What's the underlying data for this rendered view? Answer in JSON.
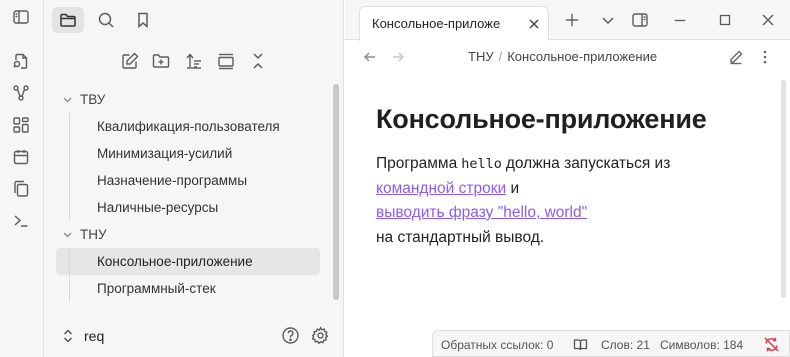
{
  "sidebar": {
    "tree": [
      {
        "label": "ТВУ",
        "expanded": true,
        "files": [
          "Квалификация-пользователя",
          "Минимизация-усилий",
          "Назначение-программы",
          "Наличные-ресурсы"
        ]
      },
      {
        "label": "ТНУ",
        "expanded": true,
        "files": [
          "Консольное-приложение",
          "Программный-стек"
        ]
      }
    ],
    "active_file": "Консольное-приложение",
    "vault_name": "req"
  },
  "tab": {
    "title": "Консольное-приложе"
  },
  "breadcrumb": {
    "folder": "ТНУ",
    "separator": "/",
    "note": "Консольное-приложение"
  },
  "note": {
    "title": "Консольное-приложение",
    "line1_text": "Программа",
    "line1_code": "hello",
    "line1_rest": "должна запускаться из",
    "link1": "командной строки",
    "and_word": "и",
    "link2": "выводить фразу \"hello, world\"",
    "line4": "на стандартный вывод."
  },
  "status": {
    "backlinks": "Обратных ссылок: 0",
    "words": "Слов: 21",
    "chars": "Символов: 184"
  },
  "colors": {
    "link": "#8a5cf5",
    "sync_error": "#e0354b",
    "active_item_bg": "#e6e6e6"
  }
}
